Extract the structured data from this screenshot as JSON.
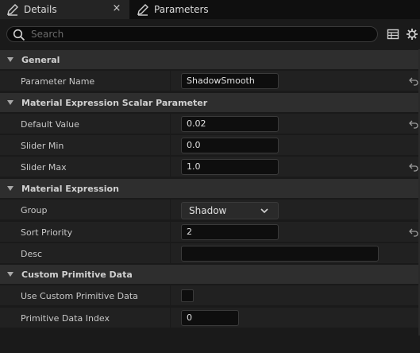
{
  "tabs": [
    {
      "label": "Details",
      "close": "×"
    },
    {
      "label": "Parameters"
    }
  ],
  "search": {
    "placeholder": "Search"
  },
  "sections": {
    "general": {
      "title": "General"
    },
    "scalar": {
      "title": "Material Expression Scalar Parameter"
    },
    "expression": {
      "title": "Material Expression"
    },
    "custom": {
      "title": "Custom Primitive Data"
    }
  },
  "rows": {
    "parameter_name": {
      "label": "Parameter Name",
      "value": "ShadowSmooth"
    },
    "default_value": {
      "label": "Default Value",
      "value": "0.02"
    },
    "slider_min": {
      "label": "Slider Min",
      "value": "0.0"
    },
    "slider_max": {
      "label": "Slider Max",
      "value": "1.0"
    },
    "group": {
      "label": "Group",
      "value": "Shadow"
    },
    "sort_priority": {
      "label": "Sort Priority",
      "value": "2"
    },
    "desc": {
      "label": "Desc",
      "value": ""
    },
    "use_custom": {
      "label": "Use Custom Primitive Data",
      "checked": false
    },
    "primitive_index": {
      "label": "Primitive Data Index",
      "value": "0"
    }
  },
  "colors": {
    "background": "#1a1a1a",
    "section": "#2e2e2e",
    "row": "#212121",
    "field": "#0e0e0e"
  }
}
